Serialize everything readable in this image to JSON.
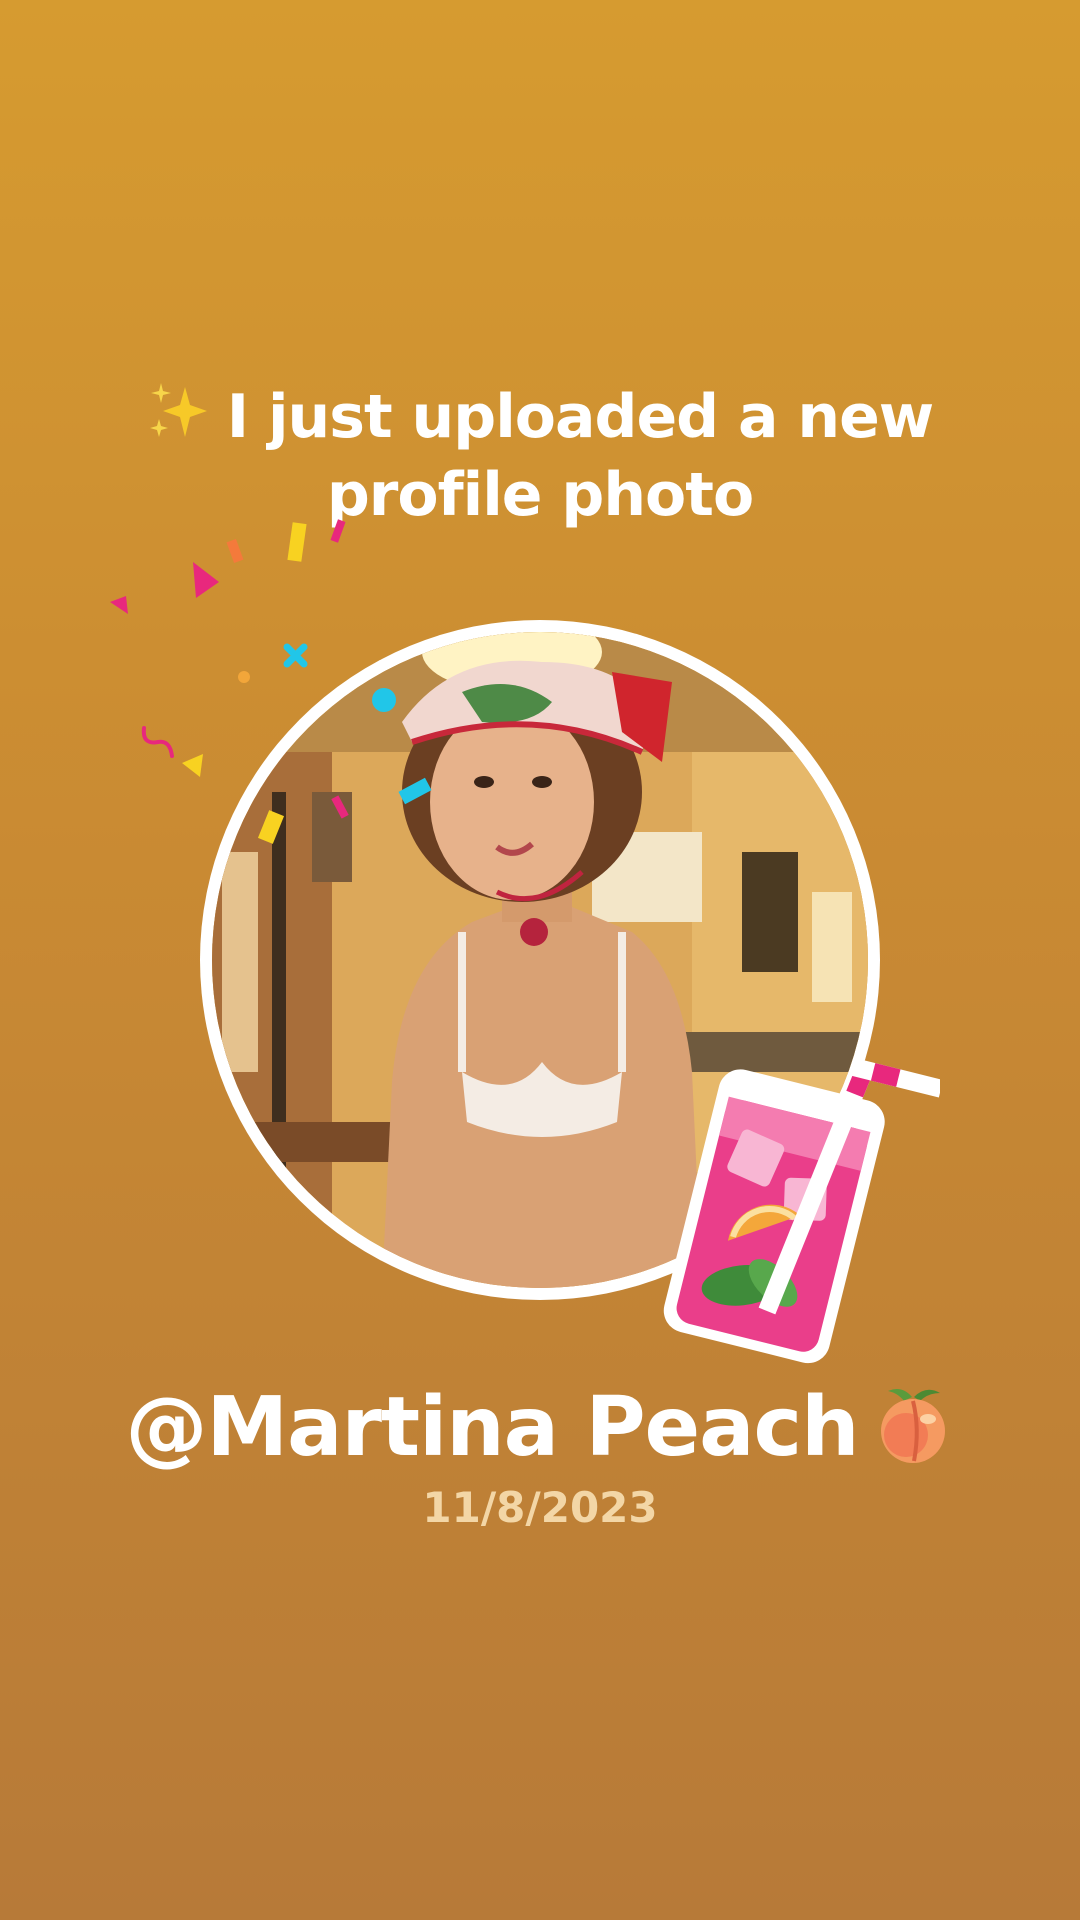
{
  "post": {
    "headline": "I just uploaded a new profile photo",
    "headline_icon": "sparkles-icon",
    "username": "@Martina Peach",
    "username_icon": "peach-icon",
    "date": "11/8/2023"
  },
  "decorations": {
    "sticker": "pink-lemonade-drink-sticker",
    "confetti": "confetti-burst"
  },
  "colors": {
    "background_top": "#d69b30",
    "background_bottom": "#b77a38",
    "text": "#ffffff",
    "date_text": "#f3d6a6",
    "ring": "#ffffff"
  }
}
